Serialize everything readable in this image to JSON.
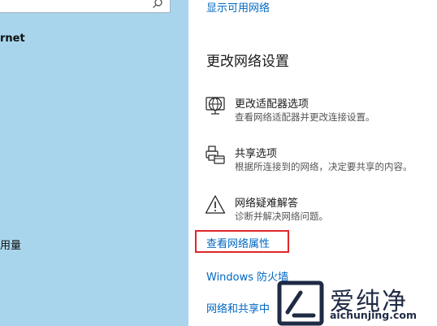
{
  "left_pane": {
    "network_label": "rnet",
    "data_usage_label": "用量"
  },
  "right_pane": {
    "show_networks_link": "显示可用网络",
    "section_title": "更改网络设置",
    "items": [
      {
        "title": "更改适配器选项",
        "desc": "查看网络适配器并更改连接设置。",
        "icon": "globe-adapter-icon"
      },
      {
        "title": "共享选项",
        "desc": "根据所连接到的网络，决定要共享的内容。",
        "icon": "printer-share-icon"
      },
      {
        "title": "网络疑难解答",
        "desc": "诊断并解决网络问题。",
        "icon": "warning-icon"
      }
    ],
    "links": {
      "view_properties": "查看网络属性",
      "firewall": "Windows 防火墙",
      "sharing_center": "网络和共享中"
    }
  },
  "watermark": {
    "brand": "爱纯净",
    "url": "aichunjing.com"
  },
  "colors": {
    "left_bg": "#a9d5ec",
    "link": "#0067c0",
    "highlight_box": "#e0262a"
  }
}
